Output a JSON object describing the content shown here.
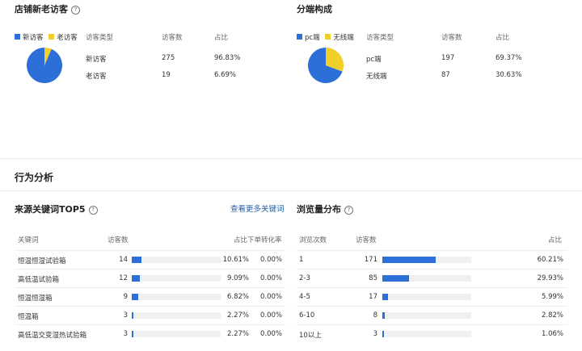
{
  "visitor": {
    "title": "店铺新老访客",
    "legend": [
      {
        "label": "新访客",
        "color": "#2d6fd8"
      },
      {
        "label": "老访客",
        "color": "#f0cf2b"
      }
    ],
    "headers": [
      "访客类型",
      "访客数",
      "占比"
    ],
    "rows": [
      {
        "type": "新访客",
        "count": "275",
        "pct": "96.83%"
      },
      {
        "type": "老访客",
        "count": "19",
        "pct": "6.69%"
      }
    ],
    "pie_fractions": [
      0.9683,
      0.0669
    ]
  },
  "device": {
    "title": "分端构成",
    "legend": [
      {
        "label": "pc端",
        "color": "#2d6fd8"
      },
      {
        "label": "无线端",
        "color": "#f0cf2b"
      }
    ],
    "headers": [
      "访客类型",
      "访客数",
      "占比"
    ],
    "rows": [
      {
        "type": "pc端",
        "count": "197",
        "pct": "69.37%"
      },
      {
        "type": "无线端",
        "count": "87",
        "pct": "30.63%"
      }
    ],
    "pie_fractions": [
      0.6937,
      0.3063
    ]
  },
  "behavior": {
    "title": "行为分析"
  },
  "keywords": {
    "title": "来源关键词TOP5",
    "more_link": "查看更多关键词",
    "headers": [
      "关键词",
      "访客数",
      "占比",
      "下单转化率"
    ],
    "rows": [
      {
        "keyword": "恒温恒湿试验箱",
        "count": "14",
        "pct": "10.61%",
        "conv": "0.00%",
        "fraction": 0.1061
      },
      {
        "keyword": "高低温试验箱",
        "count": "12",
        "pct": "9.09%",
        "conv": "0.00%",
        "fraction": 0.0909
      },
      {
        "keyword": "恒温恒湿箱",
        "count": "9",
        "pct": "6.82%",
        "conv": "0.00%",
        "fraction": 0.0682
      },
      {
        "keyword": "恒温箱",
        "count": "3",
        "pct": "2.27%",
        "conv": "0.00%",
        "fraction": 0.0227
      },
      {
        "keyword": "高低温交变湿热试验箱",
        "count": "3",
        "pct": "2.27%",
        "conv": "0.00%",
        "fraction": 0.0227
      }
    ]
  },
  "pageviews": {
    "title": "浏览量分布",
    "headers": [
      "浏览次数",
      "访客数",
      "占比"
    ],
    "rows": [
      {
        "range": "1",
        "count": "171",
        "pct": "60.21%",
        "fraction": 0.6021
      },
      {
        "range": "2-3",
        "count": "85",
        "pct": "29.93%",
        "fraction": 0.2993
      },
      {
        "range": "4-5",
        "count": "17",
        "pct": "5.99%",
        "fraction": 0.0599
      },
      {
        "range": "6-10",
        "count": "8",
        "pct": "2.82%",
        "fraction": 0.0282
      },
      {
        "range": "10以上",
        "count": "3",
        "pct": "1.06%",
        "fraction": 0.0106
      }
    ]
  }
}
